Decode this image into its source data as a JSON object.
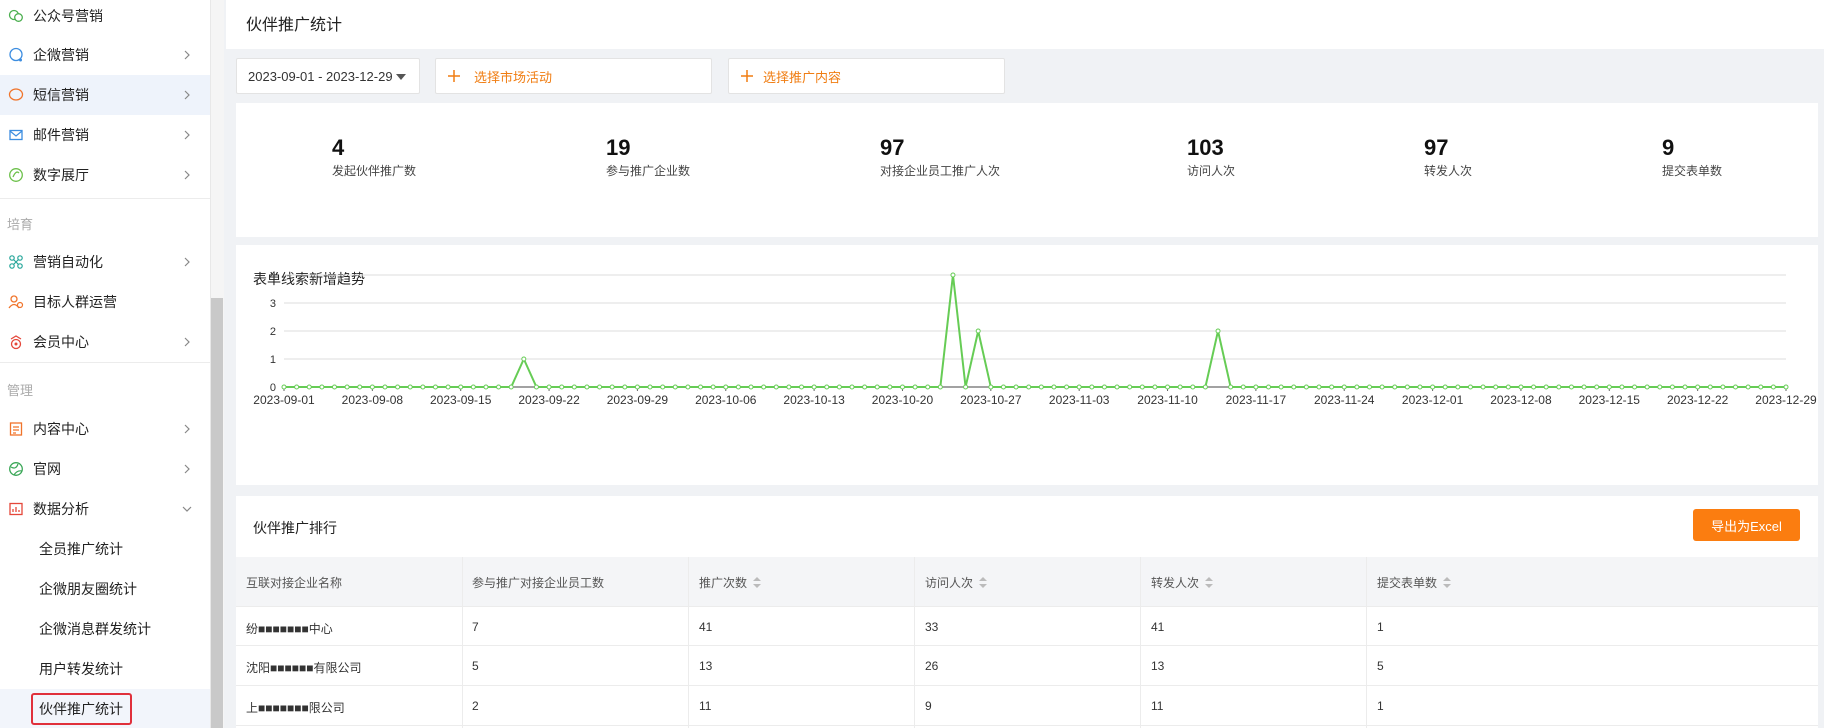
{
  "sidebar": {
    "items": [
      {
        "label": "公众号营销",
        "icon": "wechat-icon"
      },
      {
        "label": "企微营销",
        "icon": "chat-bubble-icon"
      },
      {
        "label": "短信营销",
        "icon": "sms-icon"
      },
      {
        "label": "邮件营销",
        "icon": "mail-icon"
      },
      {
        "label": "数字展厅",
        "icon": "showroom-icon"
      }
    ],
    "section_nurture": "培育",
    "nurture_items": [
      {
        "label": "营销自动化",
        "icon": "automation-icon"
      },
      {
        "label": "目标人群运营",
        "icon": "audience-icon"
      },
      {
        "label": "会员中心",
        "icon": "member-icon"
      }
    ],
    "section_manage": "管理",
    "manage_items": [
      {
        "label": "内容中心",
        "icon": "content-icon"
      },
      {
        "label": "官网",
        "icon": "website-icon"
      },
      {
        "label": "数据分析",
        "icon": "analytics-icon"
      }
    ],
    "sub_items": [
      {
        "label": "全员推广统计"
      },
      {
        "label": "企微朋友圈统计"
      },
      {
        "label": "企微消息群发统计"
      },
      {
        "label": "用户转发统计"
      },
      {
        "label": "伙伴推广统计"
      }
    ]
  },
  "page": {
    "title": "伙伴推广统计"
  },
  "filters": {
    "date_range": "2023-09-01 - 2023-12-29",
    "activity_label": "选择市场活动",
    "content_label": "选择推广内容"
  },
  "stats": [
    {
      "value": "4",
      "label": "发起伙伴推广数"
    },
    {
      "value": "19",
      "label": "参与推广企业数"
    },
    {
      "value": "97",
      "label": "对接企业员工推广人次"
    },
    {
      "value": "103",
      "label": "访问人次"
    },
    {
      "value": "97",
      "label": "转发人次"
    },
    {
      "value": "9",
      "label": "提交表单数"
    }
  ],
  "chart_data": {
    "type": "line",
    "title": "表单线索新增趋势",
    "start_date": "2023-09-01",
    "x_tick_labels": [
      "2023-09-01",
      "2023-09-08",
      "2023-09-15",
      "2023-09-22",
      "2023-09-29",
      "2023-10-06",
      "2023-10-13",
      "2023-10-20",
      "2023-10-27",
      "2023-11-03",
      "2023-11-10",
      "2023-11-17",
      "2023-11-24",
      "2023-12-01",
      "2023-12-08",
      "2023-12-15",
      "2023-12-22",
      "2023-12-29"
    ],
    "ylim": [
      0,
      4
    ],
    "y_ticks": [
      "0",
      "1",
      "2",
      "3",
      "4"
    ],
    "grid": true,
    "color": "#66cc55",
    "series": [
      {
        "nonzero_points": [
          {
            "x": "2023-09-20",
            "y": 1
          },
          {
            "x": "2023-10-24",
            "y": 4
          },
          {
            "x": "2023-10-26",
            "y": 2
          },
          {
            "x": "2023-11-14",
            "y": 2
          }
        ],
        "default_y": 0
      }
    ]
  },
  "ranking": {
    "title": "伙伴推广排行",
    "export_label": "导出为Excel",
    "columns": [
      "互联对接企业名称",
      "参与推广对接企业员工数",
      "推广次数",
      "访问人次",
      "转发人次",
      "提交表单数"
    ],
    "rows": [
      [
        "纷■■■■■■■中心",
        "7",
        "41",
        "33",
        "41",
        "1"
      ],
      [
        "沈阳■■■■■■有限公司",
        "5",
        "13",
        "26",
        "13",
        "5"
      ],
      [
        "上■■■■■■■限公司",
        "2",
        "11",
        "9",
        "11",
        "1"
      ]
    ]
  }
}
